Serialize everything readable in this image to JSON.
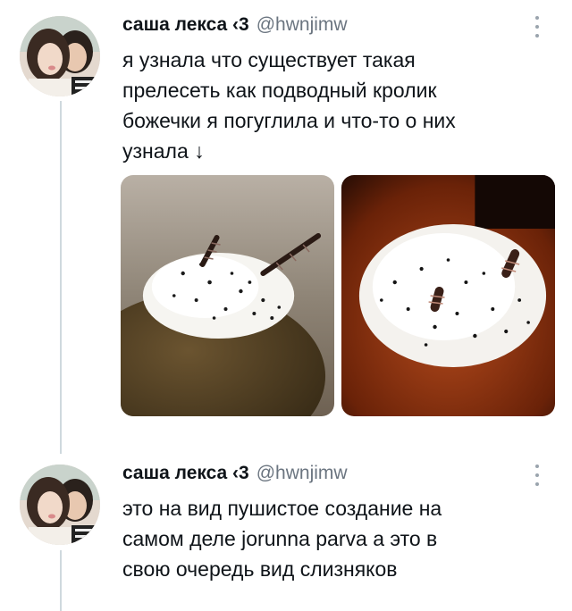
{
  "tweets": [
    {
      "author_name": "саша лекса ‹3",
      "handle": "@hwnjimw",
      "text": "я узнала что существует такая\nпрелесеть как подводный кролик\nбожечки я погуглила и что-то о них\nузнала ↓",
      "media": [
        {
          "icon": "sea-slug-photo-1"
        },
        {
          "icon": "sea-slug-photo-2"
        }
      ]
    },
    {
      "author_name": "саша лекса ‹3",
      "handle": "@hwnjimw",
      "text": "это на вид пушистое создание на\nсамом деле jorunna parva а это в\nсвою очередь вид слизняков"
    }
  ],
  "colors": {
    "handle": "#6b7580",
    "thread_line": "#cfd9de"
  }
}
